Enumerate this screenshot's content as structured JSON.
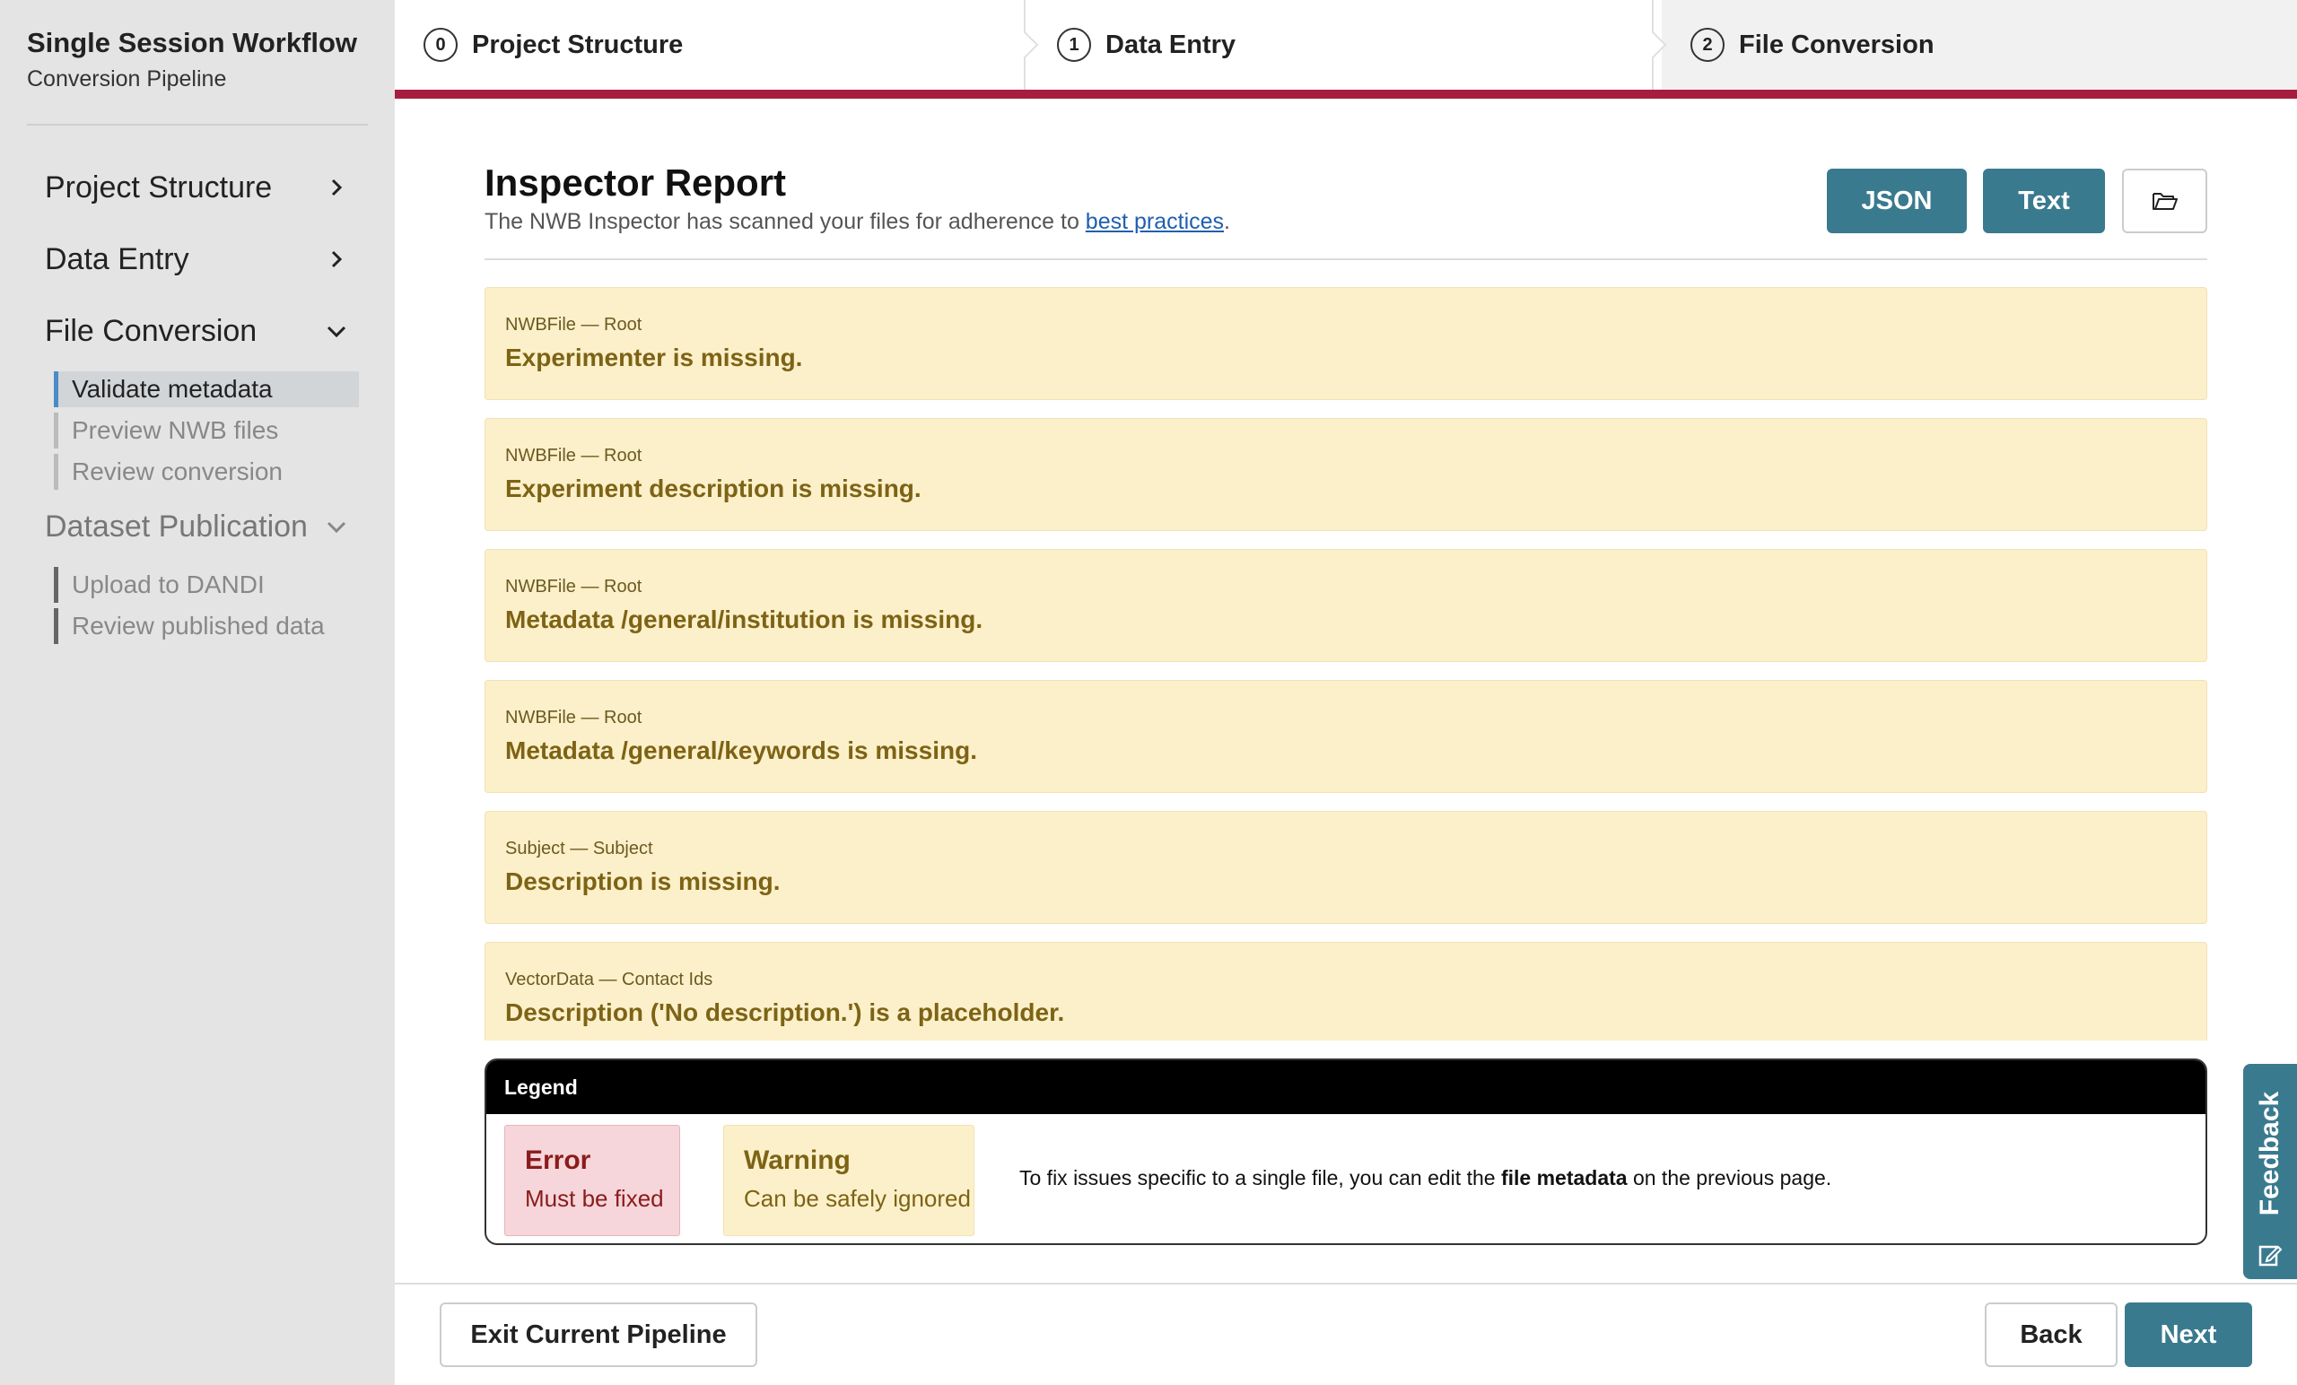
{
  "sidebar": {
    "title": "Single Session Workflow",
    "subtitle": "Conversion Pipeline",
    "sections": [
      {
        "label": "Project Structure",
        "icon": "chevron-right-icon"
      },
      {
        "label": "Data Entry",
        "icon": "chevron-right-icon"
      },
      {
        "label": "File Conversion",
        "icon": "chevron-down-icon"
      },
      {
        "label": "Dataset Publication",
        "icon": "chevron-down-icon"
      }
    ],
    "conversion_items": [
      "Validate metadata",
      "Preview NWB files",
      "Review conversion"
    ],
    "publication_items": [
      "Upload to DANDI",
      "Review published data"
    ]
  },
  "steps": [
    {
      "number": "0",
      "label": "Project Structure"
    },
    {
      "number": "1",
      "label": "Data Entry"
    },
    {
      "number": "2",
      "label": "File Conversion"
    }
  ],
  "main": {
    "title": "Inspector Report",
    "subtitle_prefix": "The NWB Inspector has scanned your files for adherence to ",
    "subtitle_link": "best practices",
    "subtitle_suffix": ".",
    "json_button": "JSON",
    "text_button": "Text",
    "folder_icon": "folder-open-icon"
  },
  "messages": [
    {
      "location": "NWBFile — Root",
      "text": "Experimenter is missing."
    },
    {
      "location": "NWBFile — Root",
      "text": "Experiment description is missing."
    },
    {
      "location": "NWBFile — Root",
      "text": "Metadata /general/institution is missing."
    },
    {
      "location": "NWBFile — Root",
      "text": "Metadata /general/keywords is missing."
    },
    {
      "location": "Subject — Subject",
      "text": "Description is missing."
    },
    {
      "location": "VectorData — Contact Ids",
      "text": "Description ('No description.') is a placeholder."
    }
  ],
  "legend": {
    "header": "Legend",
    "error_title": "Error",
    "error_desc": "Must be fixed",
    "warning_title": "Warning",
    "warning_desc": "Can be safely ignored",
    "note_prefix": "To fix issues specific to a single file, you can edit the ",
    "note_bold": "file metadata",
    "note_suffix": " on the previous page."
  },
  "footer": {
    "exit_label": "Exit Current Pipeline",
    "back_label": "Back",
    "next_label": "Next"
  },
  "feedback": {
    "label": "Feedback"
  },
  "colors": {
    "accent": "#3a7a8f",
    "progress_bar": "#a61d3f",
    "warning_bg": "#fcf0ca",
    "warning_text": "#7d6315",
    "error_bg": "#f6d6da",
    "error_text": "#8a1c1c",
    "sidebar_bg": "#e4e4e4"
  }
}
